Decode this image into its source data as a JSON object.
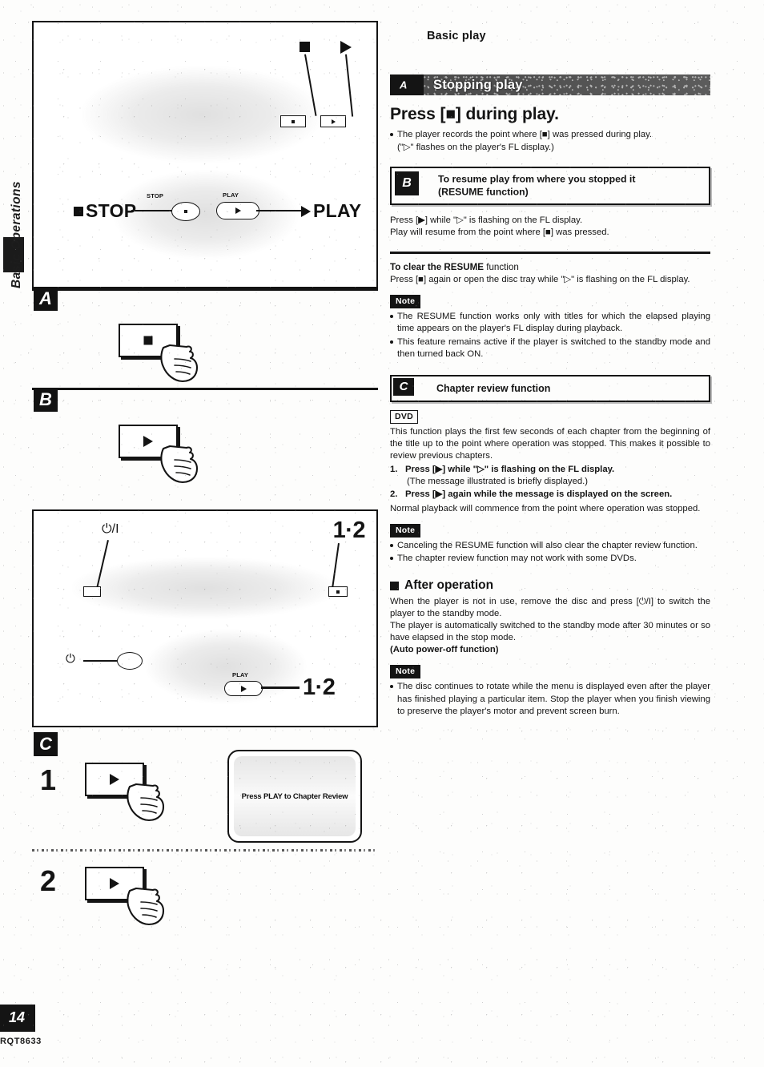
{
  "document": {
    "side_tab_label": "Basic Operations",
    "page_number": "14",
    "doc_code": "RQT8633"
  },
  "right_column": {
    "title": "Basic play",
    "section_a": {
      "badge": "A",
      "banner_title": "Stopping play",
      "heading": "Press [■] during play.",
      "bullets": [
        "The player records the point where [■] was pressed during play.",
        "(\"▷\" flashes on the player's FL display.)"
      ]
    },
    "section_b": {
      "badge": "B",
      "title_line1": "To resume play from where you stopped it",
      "title_line2": "(RESUME function)",
      "body_line1": "Press [▶] while \"▷\" is flashing on the FL display.",
      "body_line2": "Play will resume from the point where [■] was pressed.",
      "clear_heading_bold": "To clear the RESUME",
      "clear_heading_rest": " function",
      "clear_body": "Press [■] again or open the disc tray while \"▷\" is flashing on the FL display.",
      "note_label": "Note",
      "notes": [
        "The RESUME function works only with titles for which the elapsed playing time appears on the player's FL display during playback.",
        "This feature remains active if the player is switched to the standby mode and then turned back ON."
      ]
    },
    "section_c": {
      "badge": "C",
      "title": "Chapter review function",
      "disc_tag": "DVD",
      "intro": "This function plays the first few seconds of each chapter from the beginning of the title up to the point where operation was stopped. This makes it possible to review previous chapters.",
      "steps": [
        {
          "num": "1.",
          "bold": "Press [▶] while \"▷\" is flashing on the FL display.",
          "plain": "(The message illustrated is briefly displayed.)"
        },
        {
          "num": "2.",
          "bold": "Press [▶] again while the message is displayed on the screen.",
          "plain": ""
        }
      ],
      "outro": "Normal playback will commence from the point where operation was stopped.",
      "note_label": "Note",
      "notes": [
        "Canceling the RESUME function will also clear the chapter review function.",
        "The chapter review function may not work with some DVDs."
      ]
    },
    "after_operation": {
      "heading": "After operation",
      "paragraph1": "When the player is not in use, remove the disc and press [⏻/I] to switch the player to the standby mode.",
      "paragraph2": "The player is automatically switched to the standby mode after 30 minutes or so have elapsed in the stop mode.",
      "bold_line": "(Auto power-off function)",
      "note_label": "Note",
      "notes": [
        "The disc continues to rotate while the menu is displayed even after the player has finished playing a particular item. Stop the player when you finish viewing to preserve the player's motor and prevent screen burn."
      ]
    }
  },
  "left_column": {
    "panel_top": {
      "callout_stop_icon": "stop-square",
      "callout_play_icon": "play-triangle",
      "stop_word": "STOP",
      "play_word": "PLAY",
      "stop_button_caption": "STOP",
      "play_button_caption": "PLAY"
    },
    "panel_a": {
      "badge": "A",
      "button_icon": "stop-square"
    },
    "panel_b": {
      "badge": "B",
      "button_icon": "play-triangle"
    },
    "panel_mid": {
      "power_callout": "⏻/I",
      "power_symbol": "⏻",
      "label_top_right": "1·2",
      "label_bottom_right": "1·2",
      "play_button_caption": "PLAY"
    },
    "panel_c": {
      "badge": "C",
      "step1_num": "1",
      "step2_num": "2",
      "button_icon": "play-triangle",
      "tv_message": "Press PLAY to Chapter Review"
    }
  }
}
